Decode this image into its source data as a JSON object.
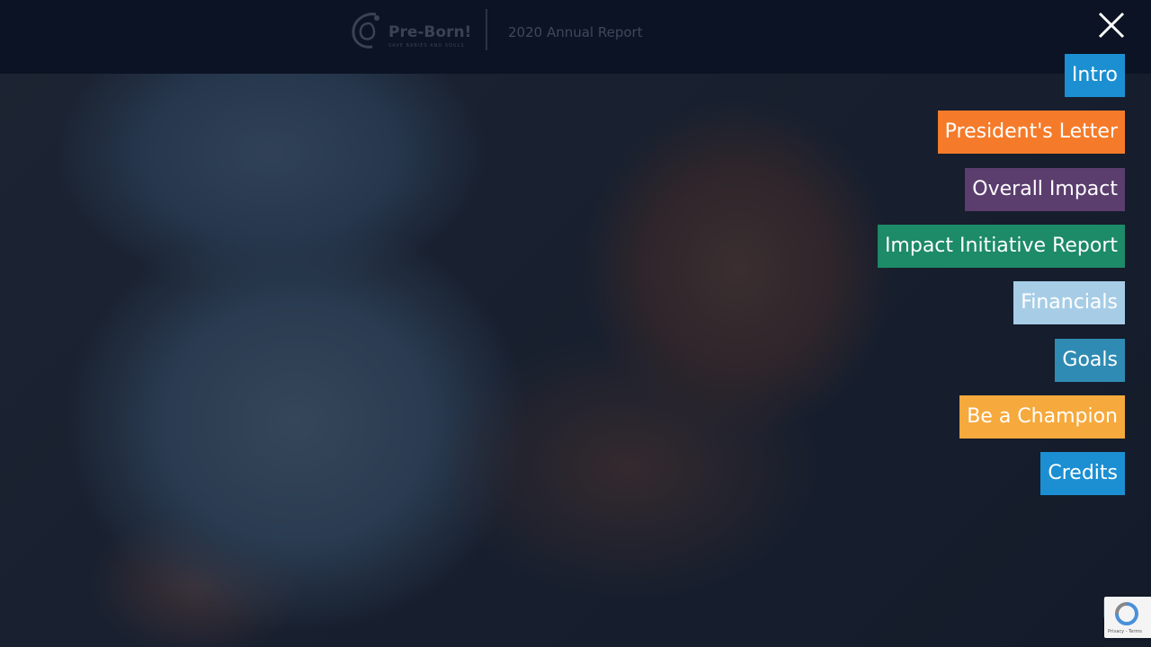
{
  "header": {
    "brand_name": "Pre-Born!",
    "brand_tagline": "SAVE BABIES AND SOULS",
    "report_title": "2020 Annual Report",
    "close_icon": "close-icon"
  },
  "nav": {
    "items": [
      {
        "label": "Intro",
        "color": "#1b8fd2"
      },
      {
        "label": "President's Letter",
        "color": "#f57b2a"
      },
      {
        "label": "Overall Impact",
        "color": "#5b3d6e"
      },
      {
        "label": "Impact Initiative Report",
        "color": "#1d8a68"
      },
      {
        "label": "Financials",
        "color": "#a7cde6"
      },
      {
        "label": "Goals",
        "color": "#2f8bb3"
      },
      {
        "label": "Be a Champion",
        "color": "#f6a93c"
      },
      {
        "label": "Credits",
        "color": "#1b8fd2"
      }
    ]
  },
  "widgets": {
    "recaptcha_text": "Privacy - Terms",
    "scroll_top_icon": "chevron-up-icon"
  },
  "colors": {
    "topbar": "#0b1324",
    "overlay": "rgba(10,20,38,0.62)"
  }
}
